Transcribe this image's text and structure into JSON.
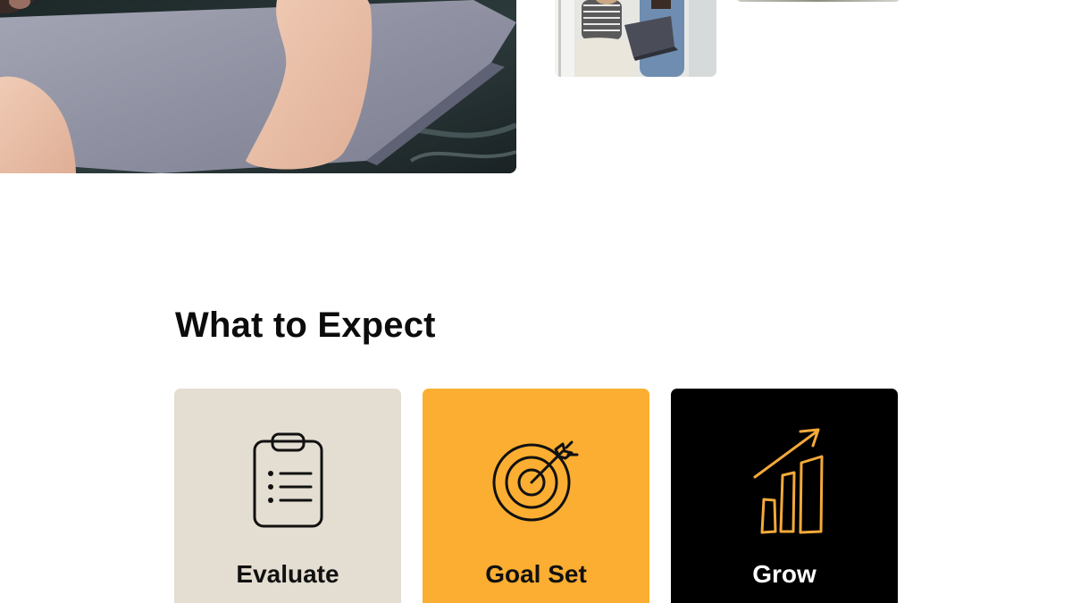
{
  "images": {
    "hero_photo_main": "laptop-hands-photo",
    "hero_photo_small": "two-people-with-laptop-photo",
    "hero_photo_third": "partial-photo"
  },
  "section": {
    "title": "What to Expect"
  },
  "cards": [
    {
      "label": "Evaluate",
      "icon": "clipboard-list-icon",
      "background": "#E4DDD1",
      "text_color": "#111111",
      "icon_color": "#111111"
    },
    {
      "label": "Goal Set",
      "icon": "target-arrow-icon",
      "background": "#FBAE31",
      "text_color": "#111111",
      "icon_color": "#111111"
    },
    {
      "label": "Grow",
      "icon": "growth-chart-icon",
      "background": "#000000",
      "text_color": "#FFFFFF",
      "icon_color": "#F4A93A"
    }
  ]
}
